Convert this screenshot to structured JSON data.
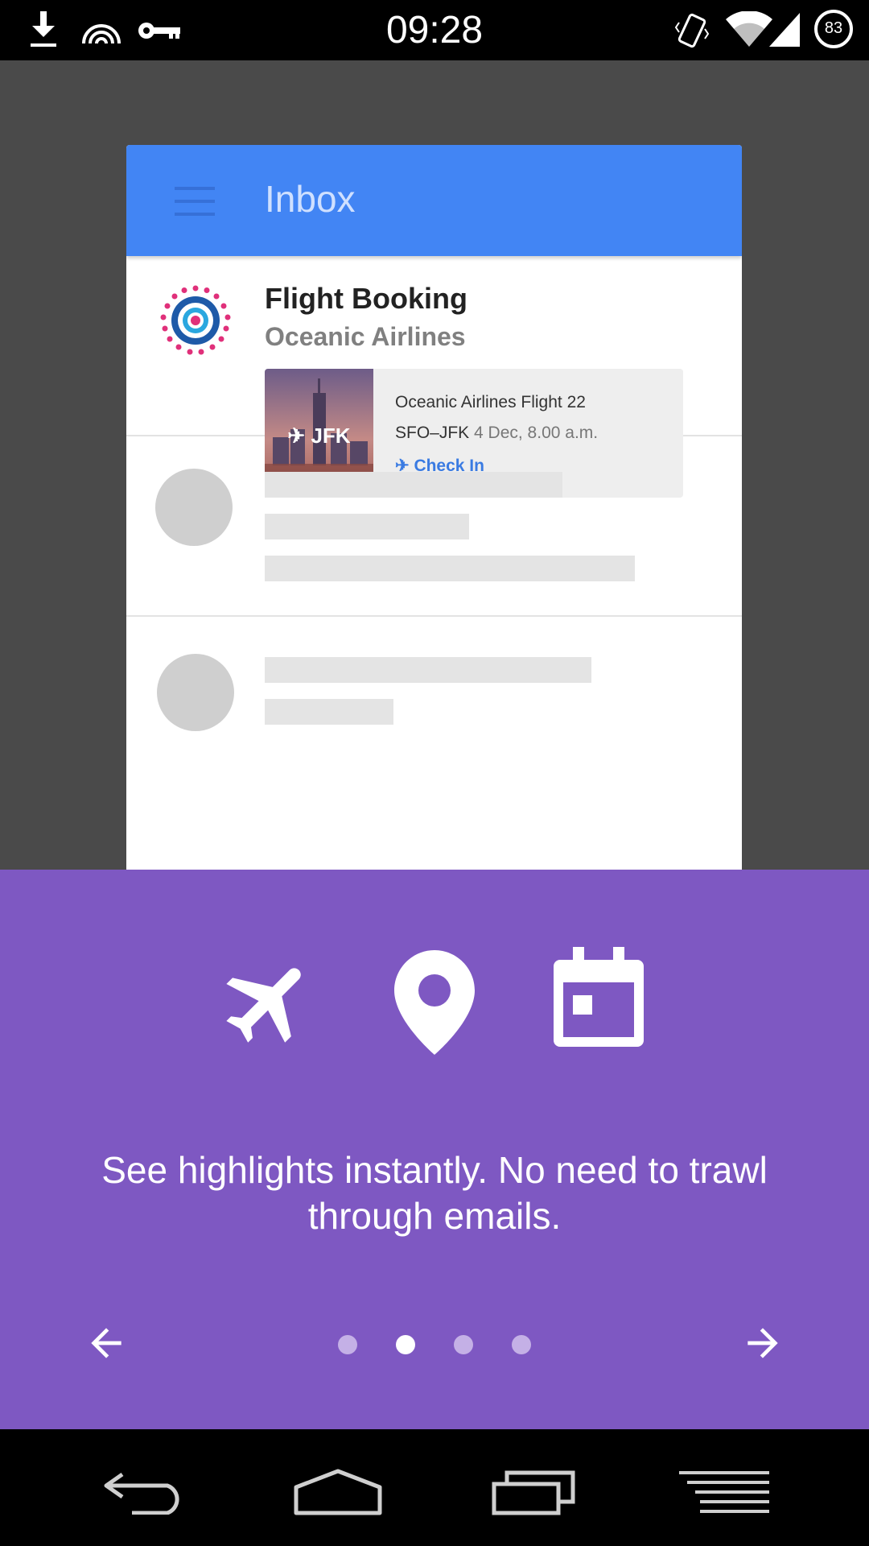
{
  "status_bar": {
    "time": "09:28",
    "battery_level": "83",
    "icons": [
      "download-icon",
      "nfc-icon",
      "vpn-key-icon",
      "vibrate-icon",
      "wifi-icon",
      "signal-icon",
      "battery-icon"
    ]
  },
  "inbox": {
    "title": "Inbox",
    "message": {
      "subject": "Flight Booking",
      "sender": "Oceanic Airlines",
      "flight_card": {
        "image_label": "JFK",
        "title": "Oceanic Airlines Flight 22",
        "route": "SFO–JFK",
        "date": "4 Dec, 8.00 a.m.",
        "action": "Check In"
      }
    }
  },
  "onboarding": {
    "feature_icons": [
      "airplane-icon",
      "location-pin-icon",
      "calendar-icon"
    ],
    "tagline": "See highlights instantly. No need to trawl through emails.",
    "page_count": 4,
    "current_page": 2
  },
  "colors": {
    "app_bar": "#4285f4",
    "panel": "#7e58c2",
    "link": "#3a7be2"
  }
}
